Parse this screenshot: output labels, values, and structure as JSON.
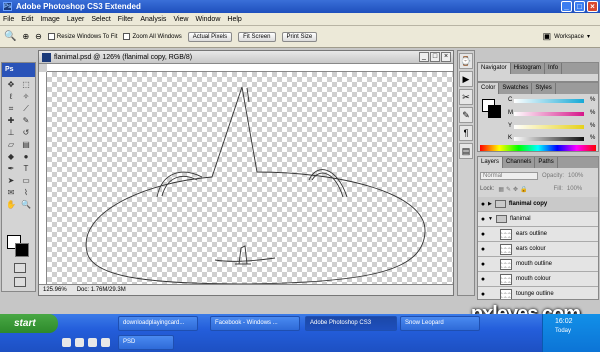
{
  "window": {
    "title": "Adobe Photoshop CS3 Extended",
    "logo": "Ps"
  },
  "menu": [
    "File",
    "Edit",
    "Image",
    "Layer",
    "Select",
    "Filter",
    "Analysis",
    "View",
    "Window",
    "Help"
  ],
  "options": {
    "resize_windows": "Resize Windows To Fit",
    "zoom_all": "Zoom All Windows",
    "actual_pixels": "Actual Pixels",
    "fit_screen": "Fit Screen",
    "print_size": "Print Size",
    "workspace": "Workspace"
  },
  "toolbox": {
    "header": "Ps"
  },
  "document": {
    "title": "flanimal.psd @ 126% (flanimal copy, RGB/8)",
    "zoom": "125.96%",
    "doc_info": "Doc: 1.76M/29.3M"
  },
  "navigator": {
    "tabs": [
      "Navigator",
      "Histogram",
      "Info"
    ]
  },
  "color": {
    "tabs": [
      "Color",
      "Swatches",
      "Styles"
    ],
    "channels": [
      {
        "label": "C",
        "value": "%",
        "color": "#16a9d6"
      },
      {
        "label": "M",
        "value": "%",
        "color": "#d6168a"
      },
      {
        "label": "Y",
        "value": "%",
        "color": "#e6d21a"
      },
      {
        "label": "K",
        "value": "%",
        "color": "#111111"
      }
    ]
  },
  "layers": {
    "tabs": [
      "Layers",
      "Channels",
      "Paths"
    ],
    "blend_mode": "Normal",
    "opacity_label": "Opacity:",
    "opacity": "100%",
    "lock_label": "Lock:",
    "fill_label": "Fill:",
    "fill": "100%",
    "items": [
      {
        "name": "flanimal copy",
        "type": "group",
        "bold": true,
        "selected": true
      },
      {
        "name": "flanimal",
        "type": "group",
        "bold": false
      },
      {
        "name": "ears outline",
        "type": "layer"
      },
      {
        "name": "ears colour",
        "type": "layer"
      },
      {
        "name": "mouth outline",
        "type": "layer"
      },
      {
        "name": "mouth colour",
        "type": "layer"
      },
      {
        "name": "tounge outline",
        "type": "layer"
      }
    ]
  },
  "taskbar": {
    "start": "start",
    "buttons": [
      "downloadplayingcard...",
      "Facebook - Windows ...",
      "Adobe Photoshop CS3",
      "Snow Leopard"
    ],
    "second_row": "PSD",
    "clock": "16:02",
    "tray_sub": "Today"
  },
  "watermark": "pxleyes.com"
}
